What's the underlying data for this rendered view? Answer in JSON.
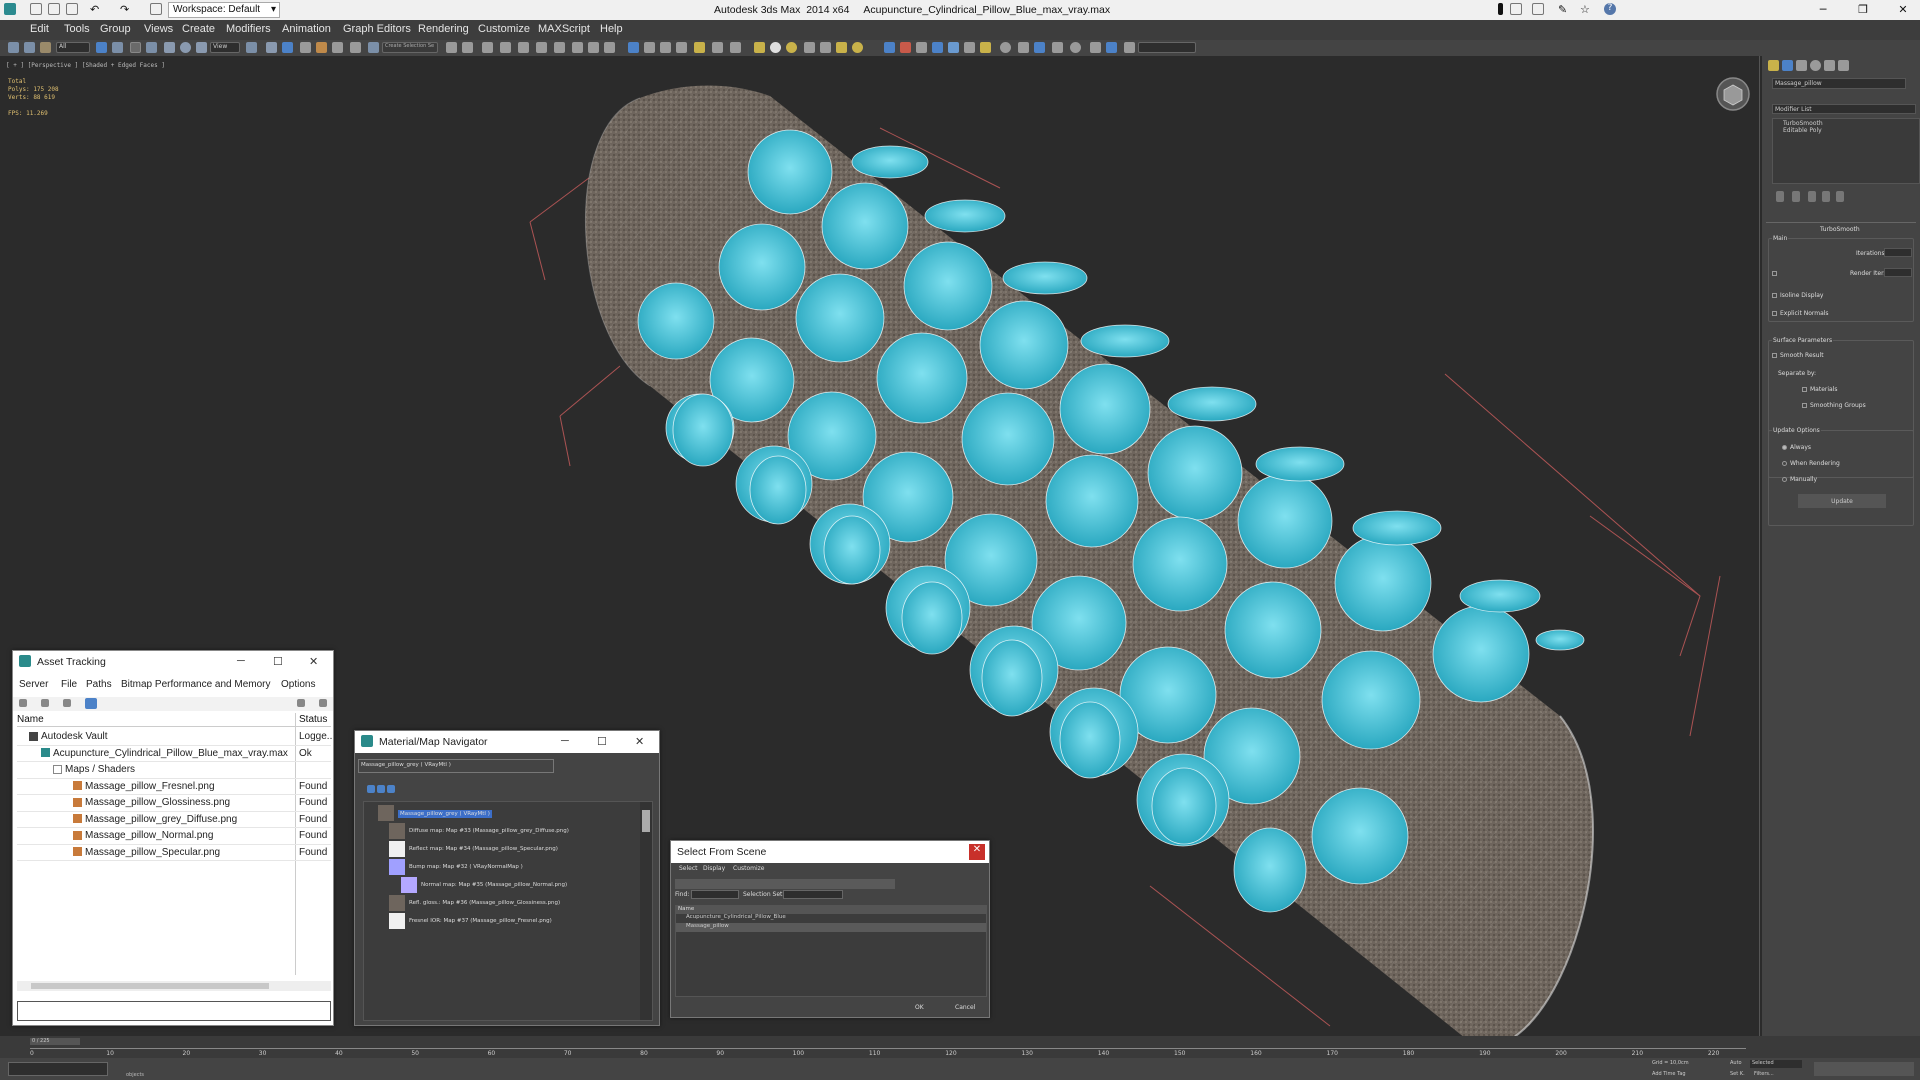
{
  "title_bar": {
    "workspace": "Workspace: Default",
    "title": "Autodesk 3ds Max  2014 x64     Acupuncture_Cylindrical_Pillow_Blue_max_vray.max"
  },
  "menu": [
    "Edit",
    "Tools",
    "Group",
    "Views",
    "Create",
    "Modifiers",
    "Animation",
    "Graph Editors",
    "Rendering",
    "Customize",
    "MAXScript",
    "Help"
  ],
  "toolbar": {
    "selection_filter": "All",
    "ref_coord": "View",
    "named_sel": "Create Selection Se"
  },
  "viewport": {
    "label": "[ + ] [Perspective ] [Shaded + Edged Faces ]",
    "stats": {
      "total_label": "Total",
      "polys_label": "Polys:",
      "polys": "175 208",
      "verts_label": "Verts:",
      "verts": "88 619",
      "fps_label": "FPS:",
      "fps": "11.269"
    }
  },
  "command_panel": {
    "object_name": "Massage_pillow",
    "modifier_list": "Modifier List",
    "stack": [
      "TurboSmooth",
      "Editable Poly"
    ],
    "rollout_title": "TurboSmooth",
    "main_group": "Main",
    "iterations_label": "Iterations:",
    "iterations_value": "0",
    "render_iters_label": "Render Iters:",
    "render_iters_value": "2",
    "isoline": "Isoline Display",
    "explicit": "Explicit Normals",
    "surface_group": "Surface Parameters",
    "smooth_result": "Smooth Result",
    "separate_by": "Separate by:",
    "materials": "Materials",
    "smoothing_groups": "Smoothing Groups",
    "update_group": "Update Options",
    "always": "Always",
    "when_rendering": "When Rendering",
    "manually": "Manually",
    "update_button": "Update"
  },
  "asset_tracking": {
    "title": "Asset Tracking",
    "menu": [
      "Server",
      "File",
      "Paths",
      "Bitmap Performance and Memory",
      "Options"
    ],
    "col_name": "Name",
    "col_status": "Status",
    "rows": [
      {
        "name": "Autodesk Vault",
        "status": "Logge..."
      },
      {
        "name": "Acupuncture_Cylindrical_Pillow_Blue_max_vray.max",
        "status": "Ok"
      },
      {
        "name": "Maps / Shaders",
        "status": ""
      },
      {
        "name": "Massage_pillow_Fresnel.png",
        "status": "Found"
      },
      {
        "name": "Massage_pillow_Glossiness.png",
        "status": "Found"
      },
      {
        "name": "Massage_pillow_grey_Diffuse.png",
        "status": "Found"
      },
      {
        "name": "Massage_pillow_Normal.png",
        "status": "Found"
      },
      {
        "name": "Massage_pillow_Specular.png",
        "status": "Found"
      }
    ]
  },
  "material_navigator": {
    "title": "Material/Map Navigator",
    "field": "Massage_pillow_grey  ( VRayMtl )",
    "rows": [
      "Massage_pillow_grey  ( VRayMtl )",
      "Diffuse map: Map #33 (Massage_pillow_grey_Diffuse.png)",
      "Reflect map: Map #34 (Massage_pillow_Specular.png)",
      "Bump map: Map #32  ( VRayNormalMap )",
      "Normal map: Map #35 (Massage_pillow_Normal.png)",
      "Refl. gloss.: Map #36 (Massage_pillow_Glossiness.png)",
      "Fresnel IOR: Map #37 (Massage_pillow_Fresnel.png)"
    ]
  },
  "select_from_scene": {
    "title": "Select From Scene",
    "menu": [
      "Select",
      "Display",
      "Customize"
    ],
    "find_label": "Find:",
    "selection_set_label": "Selection Set:",
    "col_name": "Name",
    "items": [
      "Acupuncture_Cylindrical_Pillow_Blue",
      "Massage_pillow"
    ],
    "ok": "OK",
    "cancel": "Cancel"
  },
  "timeline": {
    "frame": "0 / 225",
    "ticks": [
      "0",
      "10",
      "20",
      "30",
      "40",
      "50",
      "60",
      "70",
      "80",
      "90",
      "100",
      "110",
      "120",
      "130",
      "140",
      "150",
      "160",
      "170",
      "180",
      "190",
      "200",
      "210",
      "220"
    ]
  },
  "status_bar": {
    "prompt": "objects",
    "grid": "Grid = 10,0cm",
    "add_time_tag": "Add Time Tag",
    "auto": "Auto",
    "set_k": "Set K.",
    "selected": "Selected",
    "filters": "Filters..."
  }
}
